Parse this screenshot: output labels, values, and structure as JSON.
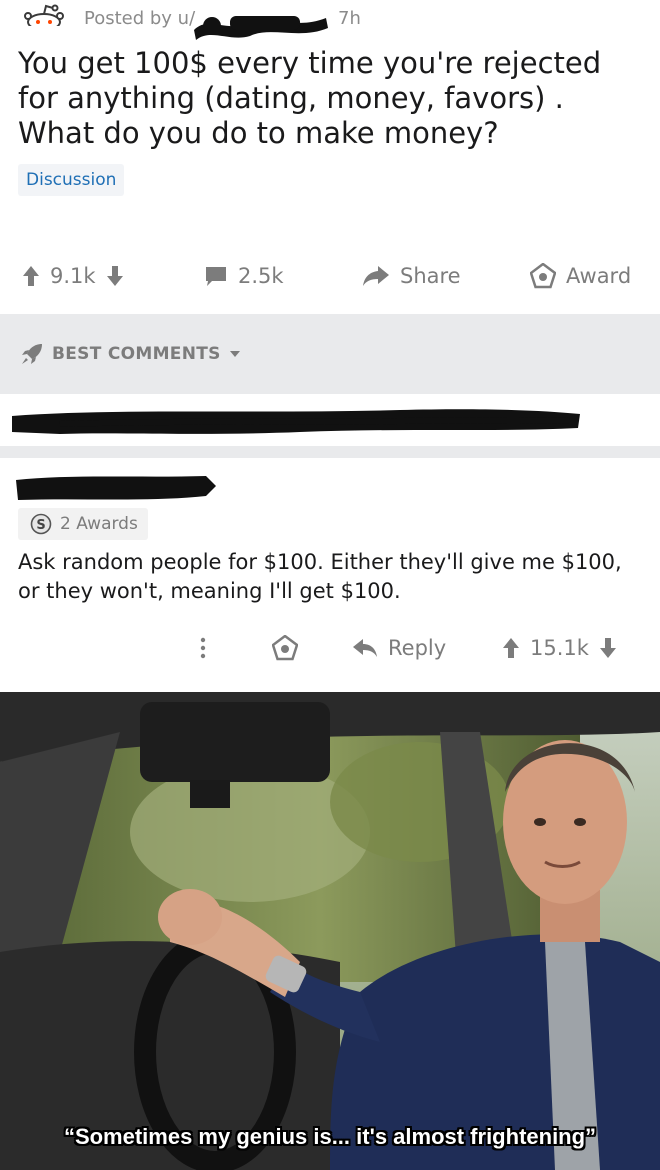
{
  "post": {
    "posted_by": "Posted by u/",
    "time": "7h",
    "title": "You get 100$ every time you're rejected for anything (dating, money, favors) . What do you do to make money?",
    "flair": "Discussion",
    "votes": "9.1k",
    "comments": "2.5k",
    "share_label": "Share",
    "award_label": "Award"
  },
  "sort": {
    "label": "BEST COMMENTS"
  },
  "comment": {
    "awards": "2 Awards",
    "body": "Ask random people for $100. Either they'll give me $100, or they won't, meaning I'll get $100.",
    "reply_label": "Reply",
    "votes": "15.1k"
  },
  "meme": {
    "caption": "“Sometimes my genius is... it's almost frightening”"
  },
  "colors": {
    "text": "#1a1a1b",
    "muted": "#7c7c7c",
    "flair_text": "#1f6fb5",
    "divider": "#e9eaec",
    "redaction": "#111111"
  },
  "icons": [
    "snoo-icon",
    "upvote-icon",
    "downvote-icon",
    "comment-icon",
    "share-icon",
    "award-icon",
    "rocket-icon",
    "caret-down-icon",
    "silver-award-icon",
    "more-icon",
    "reply-icon"
  ]
}
